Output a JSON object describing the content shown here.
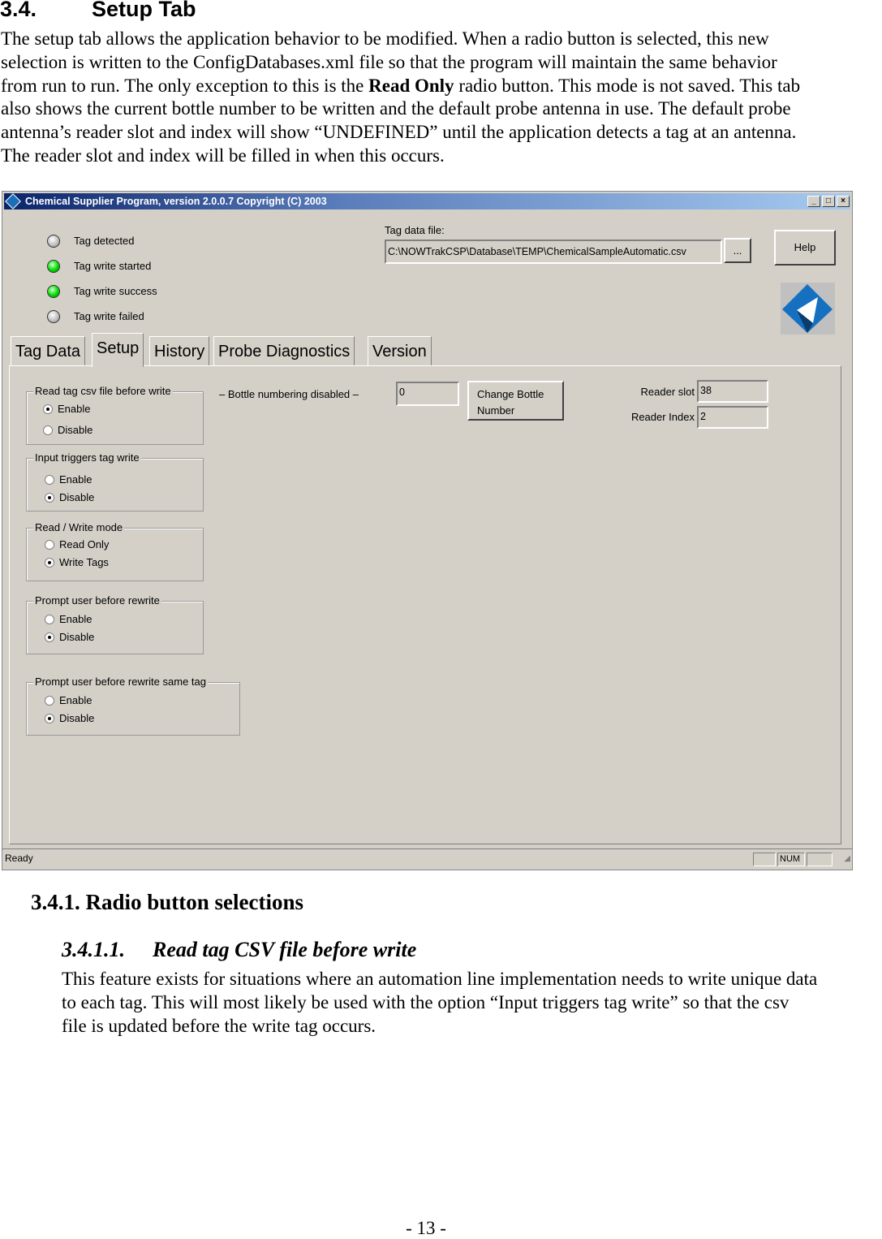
{
  "section": {
    "number": "3.4.",
    "title": "Setup Tab"
  },
  "intro": [
    "The setup tab allows the application behavior to be modified. When a radio button is selected, this new",
    "selection is written to the ConfigDatabases.xml file so that the program will maintain the same behavior",
    "from run to run. The only exception to this is the ",
    "Read Only",
    " radio button. This mode is not saved. This tab",
    "also shows the current bottle number to be written and the default probe antenna in use. The default probe",
    "antenna’s reader slot and index will show “UNDEFINED” until the application detects a tag at an antenna.",
    "The reader slot and index will be filled in when this occurs."
  ],
  "window": {
    "title": "Chemical Supplier Program, version 2.0.0.7 Copyright (C) 2003",
    "controls": [
      "_",
      "□",
      "×"
    ],
    "indicators": [
      {
        "label": "Tag detected",
        "color": "gray"
      },
      {
        "label": "Tag write started",
        "color": "green"
      },
      {
        "label": "Tag write success",
        "color": "green"
      },
      {
        "label": "Tag write failed",
        "color": "gray"
      }
    ],
    "tag_file_label": "Tag data file:",
    "tag_file_value": "C:\\NOWTrakCSP\\Database\\TEMP\\ChemicalSampleAutomatic.csv",
    "browse_label": "...",
    "help_label": "Help",
    "tabs": [
      "Tag Data",
      "Setup",
      "History",
      "Probe Diagnostics",
      "Version"
    ],
    "active_tab": "Setup",
    "groups": [
      {
        "legend": "Read tag csv file before write",
        "options": [
          "Enable",
          "Disable"
        ],
        "selected": 0
      },
      {
        "legend": "Input triggers tag write",
        "options": [
          "Enable",
          "Disable"
        ],
        "selected": 1
      },
      {
        "legend": "Read / Write mode",
        "options": [
          "Read Only",
          "Write Tags"
        ],
        "selected": 1
      },
      {
        "legend": "Prompt user before rewrite",
        "options": [
          "Enable",
          "Disable"
        ],
        "selected": 1
      },
      {
        "legend": "Prompt user before rewrite same tag",
        "options": [
          "Enable",
          "Disable"
        ],
        "selected": 1
      }
    ],
    "bottle_label": "– Bottle numbering disabled –",
    "bottle_value": "0",
    "change_bottle_label": [
      "Change Bottle",
      "Number"
    ],
    "reader_slot_label": "Reader slot",
    "reader_slot_value": "38",
    "reader_index_label": "Reader Index",
    "reader_index_value": "2",
    "status": {
      "text": "Ready",
      "num": "NUM"
    }
  },
  "sub1": {
    "number": "3.4.1.",
    "title": "Radio button selections"
  },
  "sub2": {
    "number": "3.4.1.1.",
    "title": "Read tag CSV file before write"
  },
  "body2": [
    "This feature exists for situations where an automation line implementation needs to write unique data",
    "to each tag. This will most likely be used with the option “Input triggers tag write” so that the csv",
    "file is updated before the write tag occurs."
  ],
  "footer": "- 13 -"
}
